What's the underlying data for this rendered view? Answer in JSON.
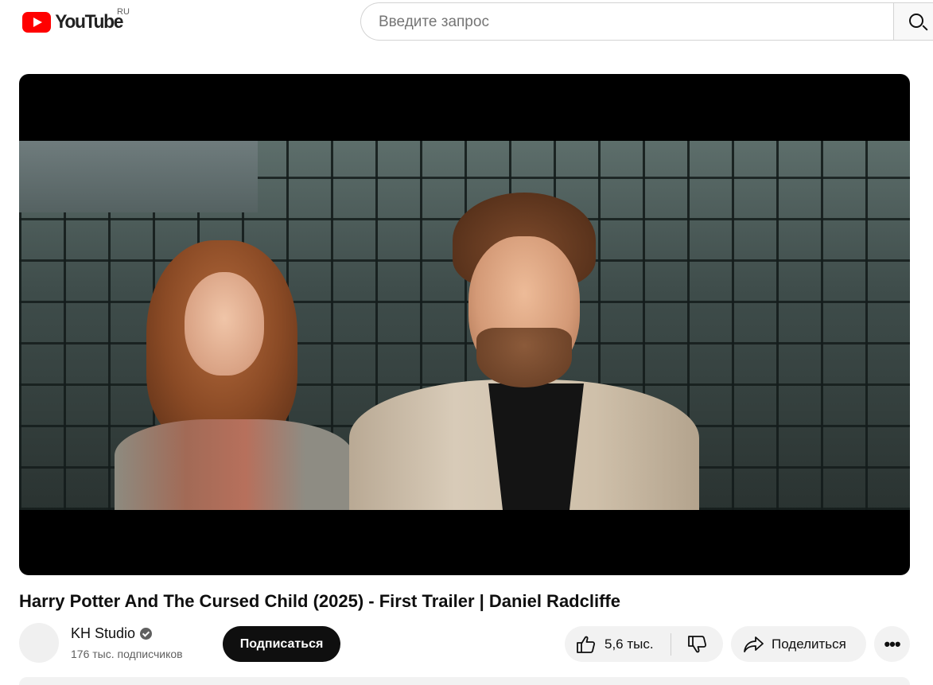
{
  "header": {
    "logo_text": "YouTube",
    "region": "RU",
    "search_placeholder": "Введите запрос"
  },
  "video": {
    "title": "Harry Potter And The Cursed Child (2025) - First Trailer | Daniel Radcliffe"
  },
  "channel": {
    "name": "KH Studio",
    "subscribers": "176 тыс. подписчиков",
    "subscribe_label": "Подписаться"
  },
  "actions": {
    "like_count": "5,6 тыс.",
    "share_label": "Поделиться",
    "more_label": "•••"
  }
}
